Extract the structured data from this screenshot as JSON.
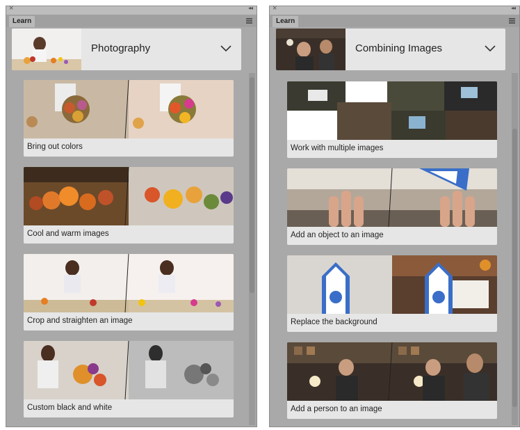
{
  "panels": [
    {
      "tab_label": "Learn",
      "topic_title": "Photography",
      "cards": [
        {
          "label": "Bring out colors"
        },
        {
          "label": "Cool and warm images"
        },
        {
          "label": "Crop and straighten an image"
        },
        {
          "label": "Custom black and white"
        }
      ]
    },
    {
      "tab_label": "Learn",
      "topic_title": "Combining Images",
      "cards": [
        {
          "label": "Work with multiple images"
        },
        {
          "label": "Add an object to an image"
        },
        {
          "label": "Replace the background"
        },
        {
          "label": "Add a person to an image"
        }
      ]
    }
  ],
  "icons": {
    "close": "close-icon",
    "collapse": "collapse-icon",
    "menu": "panel-menu-icon",
    "dropdown": "chevron-down-icon"
  }
}
